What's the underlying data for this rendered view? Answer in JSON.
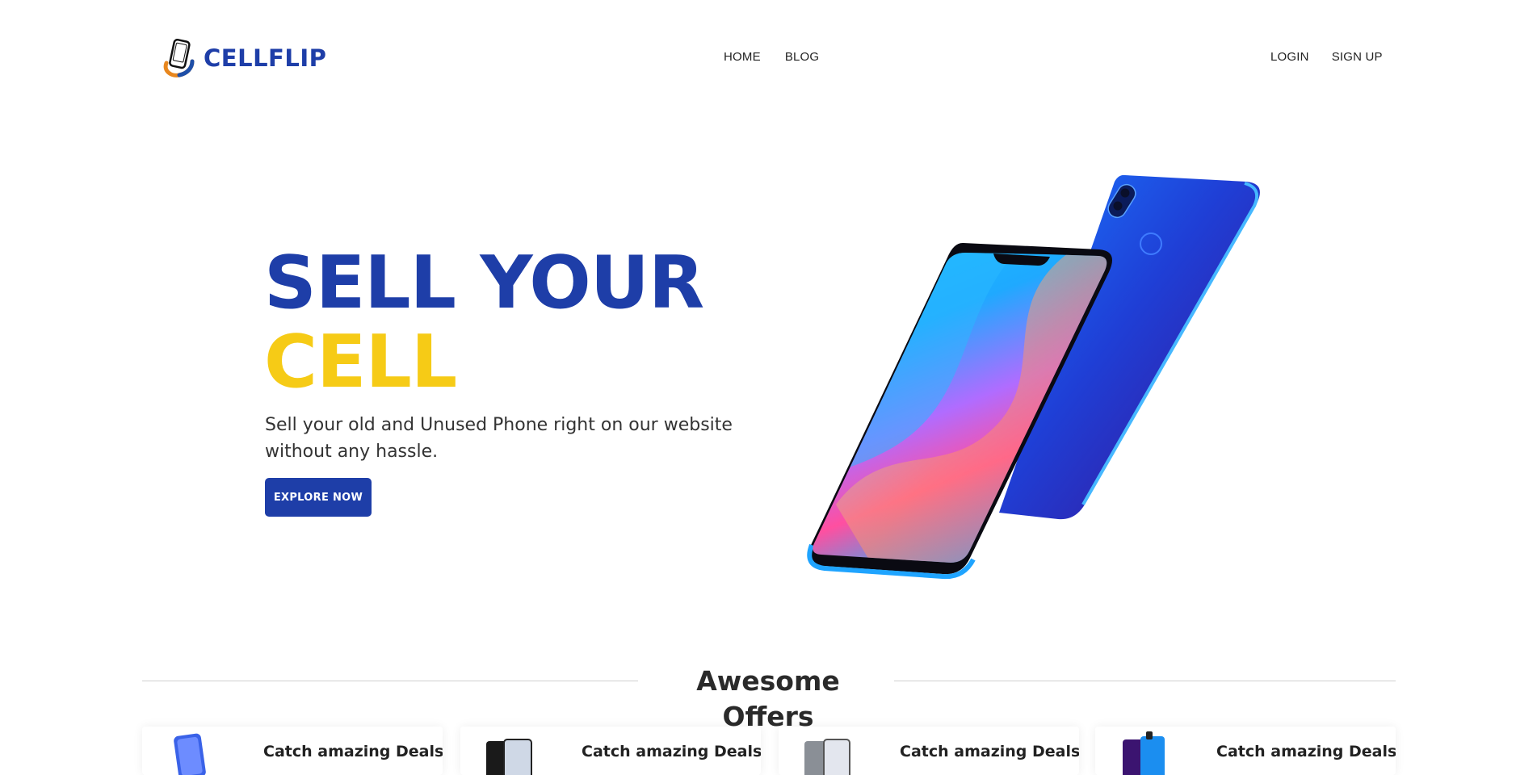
{
  "brand": {
    "name": "CELLFLIP"
  },
  "nav": {
    "center": [
      {
        "label": "HOME"
      },
      {
        "label": "BLOG"
      }
    ],
    "right": [
      {
        "label": "LOGIN"
      },
      {
        "label": "SIGN UP"
      }
    ]
  },
  "hero": {
    "title_line1": "SELL YOUR",
    "title_line2": "CELL",
    "subtitle": "Sell your old and Unused Phone right on our website without any hassle.",
    "cta_label": "EXPLORE NOW"
  },
  "offers": {
    "heading": "Awesome Offers",
    "cards": [
      {
        "title": "Catch amazing Deals",
        "thumb_icon": "phone-blue-thumbnail"
      },
      {
        "title": "Catch amazing Deals",
        "thumb_icon": "phone-black-thumbnail"
      },
      {
        "title": "Catch amazing Deals",
        "thumb_icon": "phone-silver-thumbnail"
      },
      {
        "title": "Catch amazing Deals",
        "thumb_icon": "phone-purple-thumbnail"
      }
    ]
  },
  "colors": {
    "brand_blue": "#1e3ea8",
    "brand_yellow": "#f6cb16",
    "text_dark": "#2b2b2b"
  }
}
